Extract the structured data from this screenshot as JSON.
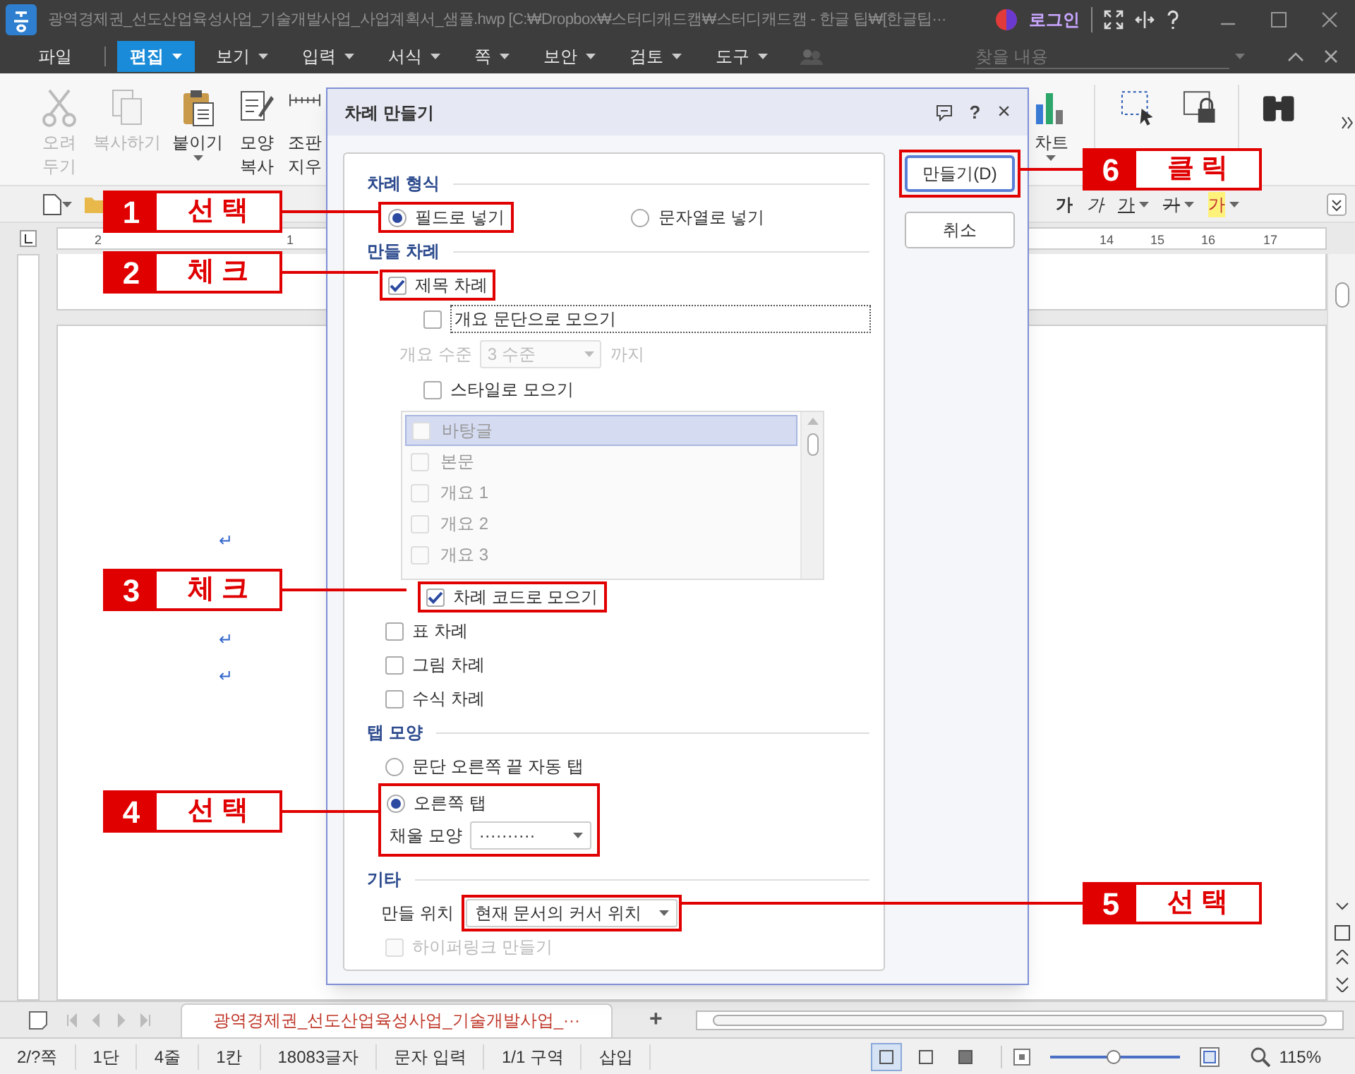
{
  "window": {
    "title": "광역경제권_선도산업육성사업_기술개발사업_사업계획서_샘플.hwp [C:₩Dropbox₩스터디캐드캠₩스터디캐드캠 - 한글 팁₩[한글팁···",
    "login": "로그인"
  },
  "menu": {
    "items": [
      {
        "label": "파일",
        "selected": false,
        "dropdown": false
      },
      {
        "label": "편집",
        "selected": true,
        "dropdown": true
      },
      {
        "label": "보기",
        "selected": false,
        "dropdown": true
      },
      {
        "label": "입력",
        "selected": false,
        "dropdown": true
      },
      {
        "label": "서식",
        "selected": false,
        "dropdown": true
      },
      {
        "label": "쪽",
        "selected": false,
        "dropdown": true
      },
      {
        "label": "보안",
        "selected": false,
        "dropdown": true
      },
      {
        "label": "검토",
        "selected": false,
        "dropdown": true
      },
      {
        "label": "도구",
        "selected": false,
        "dropdown": true
      }
    ],
    "search": {
      "placeholder": "찾을 내용"
    }
  },
  "ribbon": {
    "left": [
      {
        "kind": "cut",
        "label": "오려 두기",
        "disabled": true,
        "dropdown": false
      },
      {
        "kind": "copy",
        "label": "복사하기",
        "disabled": true,
        "dropdown": false
      },
      {
        "kind": "paste",
        "label": "붙이기",
        "disabled": false,
        "dropdown": true
      },
      {
        "kind": "format",
        "label": "모양 복사",
        "disabled": false,
        "dropdown": false
      },
      {
        "kind": "clear",
        "label": "조판 지우",
        "disabled": false,
        "dropdown": false
      }
    ],
    "right": [
      {
        "kind": "chart",
        "label": "차트",
        "disabled": false,
        "dropdown": true
      }
    ]
  },
  "format_toolbar": [
    {
      "kind": "bold",
      "label": "가"
    },
    {
      "kind": "italic",
      "label": "가"
    },
    {
      "kind": "underline",
      "label": "가"
    },
    {
      "kind": "strike",
      "label": "가"
    },
    {
      "kind": "highlight",
      "label": "가"
    }
  ],
  "ruler": {
    "left_numbers": [
      "2",
      "1"
    ],
    "right_numbers": [
      "14",
      "15",
      "16",
      "17"
    ]
  },
  "document": {
    "paragraph_marks": [
      "↵",
      "↵",
      "↵"
    ]
  },
  "dialog": {
    "title": "차례 만들기",
    "help": "?",
    "close": "×",
    "sections": [
      {
        "title": "차례 형식",
        "items": [
          {
            "kind": "radio_pair",
            "options": [
              {
                "label": "필드로 넣기",
                "selected": true,
                "highlighted": true
              },
              {
                "label": "문자열로 넣기",
                "selected": false,
                "highlighted": false
              }
            ]
          }
        ]
      },
      {
        "title": "만들 차례",
        "items": [
          {
            "kind": "checkbox",
            "label": "제목 차례",
            "checked": true,
            "disabled": false,
            "highlighted": true,
            "children": [
              {
                "kind": "checkbox",
                "label": "개요 문단으로 모으기",
                "checked": false,
                "disabled": false,
                "focused": true
              },
              {
                "kind": "level",
                "label": "개요 수준",
                "value": "3 수준",
                "suffix": "까지",
                "disabled": true
              },
              {
                "kind": "checkbox",
                "label": "스타일로 모으기",
                "checked": false,
                "disabled": false
              },
              {
                "kind": "list",
                "disabled": true,
                "items": [
                  {
                    "label": "바탕글",
                    "selected": true
                  },
                  {
                    "label": "본문",
                    "selected": false
                  },
                  {
                    "label": "개요 1",
                    "selected": false
                  },
                  {
                    "label": "개요 2",
                    "selected": false
                  },
                  {
                    "label": "개요 3",
                    "selected": false
                  }
                ]
              },
              {
                "kind": "checkbox",
                "label": "차례 코드로 모으기",
                "checked": true,
                "disabled": false,
                "highlighted": true
              }
            ]
          },
          {
            "kind": "checkbox",
            "label": "표 차례",
            "checked": false,
            "disabled": false
          },
          {
            "kind": "checkbox",
            "label": "그림 차례",
            "checked": false,
            "disabled": false
          },
          {
            "kind": "checkbox",
            "label": "수식 차례",
            "checked": false,
            "disabled": false
          }
        ]
      },
      {
        "title": "탭 모양",
        "items": [
          {
            "kind": "radio",
            "label": "문단 오른쪽 끝 자동 탭",
            "selected": false
          },
          {
            "kind": "radio",
            "label": "오른쪽 탭",
            "selected": true,
            "highlighted": true,
            "children": [
              {
                "kind": "select",
                "label": "채울 모양",
                "value": "··········"
              }
            ]
          }
        ]
      },
      {
        "title": "기타",
        "items": [
          {
            "kind": "select",
            "label": "만들 위치",
            "value": "현재 문서의 커서 위치",
            "highlighted": true
          },
          {
            "kind": "checkbox",
            "label": "하이퍼링크 만들기",
            "checked": false,
            "disabled": true
          }
        ]
      }
    ],
    "buttons": [
      {
        "label": "만들기(D)",
        "default": true,
        "highlighted": true
      },
      {
        "label": "취소",
        "default": false,
        "highlighted": false
      }
    ]
  },
  "callouts": [
    {
      "number": "1",
      "text": "선 택"
    },
    {
      "number": "2",
      "text": "체 크"
    },
    {
      "number": "3",
      "text": "체 크"
    },
    {
      "number": "4",
      "text": "선 택"
    },
    {
      "number": "5",
      "text": "선 택"
    },
    {
      "number": "6",
      "text": "클 릭"
    }
  ],
  "doc_tabs": [
    {
      "label": "광역경제권_선도산업육성사업_기술개발사업_···",
      "selected": true
    }
  ],
  "new_tab": "+",
  "status_bar": {
    "items": [
      "2/?쪽",
      "1단",
      "4줄",
      "1칸",
      "18083글자",
      "문자 입력",
      "1/1 구역",
      "삽입"
    ],
    "views": [
      {
        "selected": true
      },
      {
        "selected": false
      },
      {
        "selected": false
      }
    ],
    "zoom": {
      "level": 0.49,
      "reading": "115%"
    }
  }
}
